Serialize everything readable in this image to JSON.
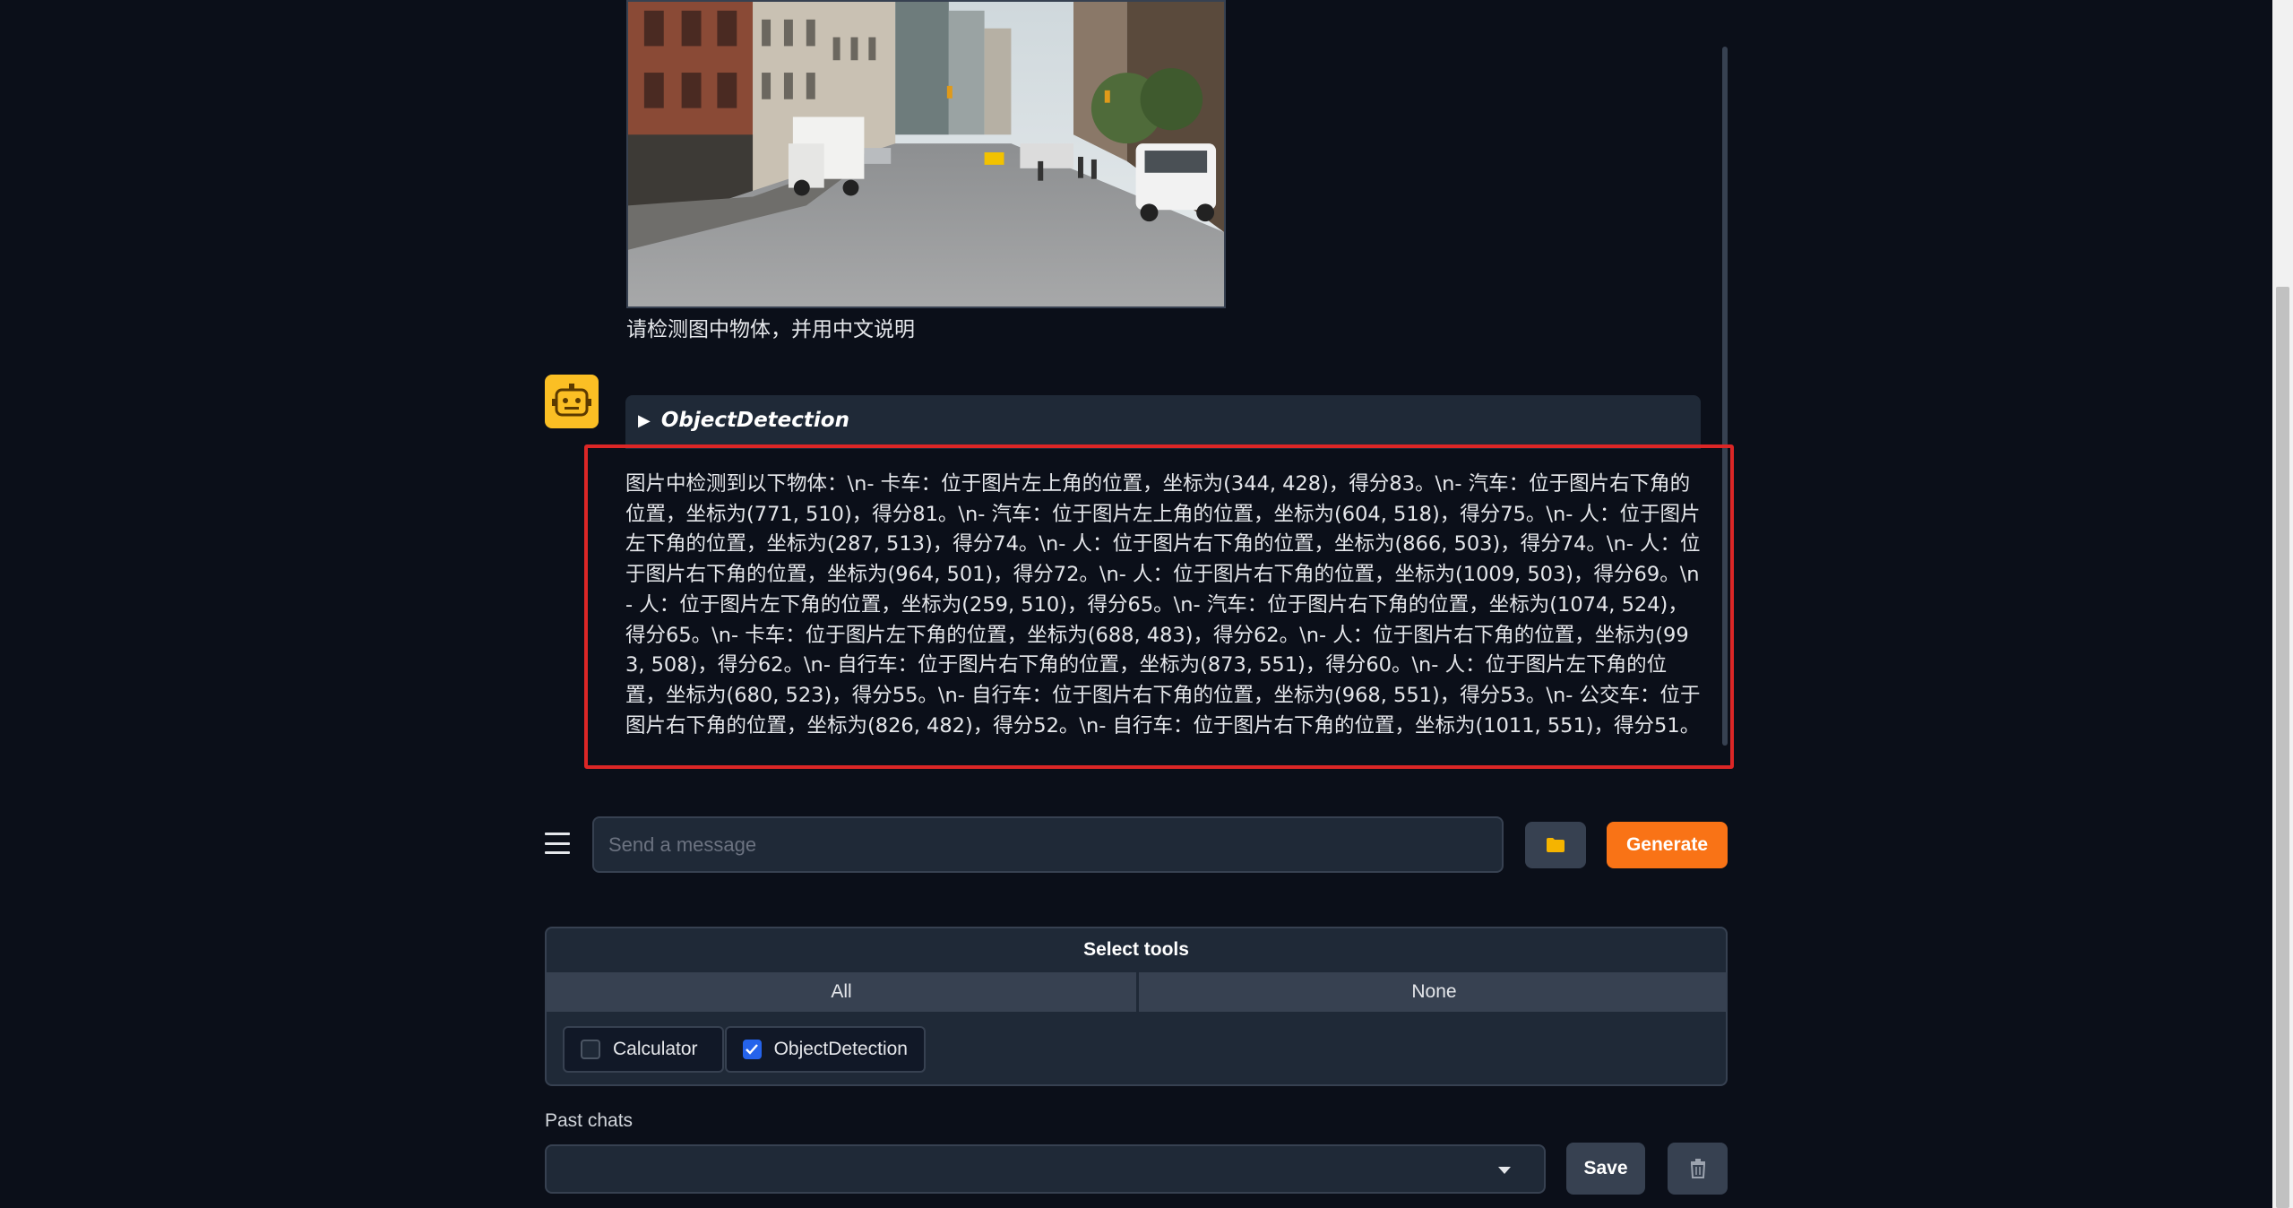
{
  "conversation": {
    "user_message": "请检测图中物体，并用中文说明",
    "tool_used": "ObjectDetection",
    "assistant_answer": "图片中检测到以下物体：\\n- 卡车：位于图片左上角的位置，坐标为(344, 428)，得分83。\\n- 汽车：位于图片右下角的位置，坐标为(771, 510)，得分81。\\n- 汽车：位于图片左上角的位置，坐标为(604, 518)，得分75。\\n- 人：位于图片左下角的位置，坐标为(287, 513)，得分74。\\n- 人：位于图片右下角的位置，坐标为(866, 503)，得分74。\\n- 人：位于图片右下角的位置，坐标为(964, 501)，得分72。\\n- 人：位于图片右下角的位置，坐标为(1009, 503)，得分69。\\n- 人：位于图片左下角的位置，坐标为(259, 510)，得分65。\\n- 汽车：位于图片右下角的位置，坐标为(1074, 524)，得分65。\\n- 卡车：位于图片左下角的位置，坐标为(688, 483)，得分62。\\n- 人：位于图片右下角的位置，坐标为(993, 508)，得分62。\\n- 自行车：位于图片右下角的位置，坐标为(873, 551)，得分60。\\n- 人：位于图片左下角的位置，坐标为(680, 523)，得分55。\\n- 自行车：位于图片右下角的位置，坐标为(968, 551)，得分53。\\n- 公交车：位于图片右下角的位置，坐标为(826, 482)，得分52。\\n- 自行车：位于图片右下角的位置，坐标为(1011, 551)，得分51。"
  },
  "input": {
    "placeholder": "Send a message",
    "generate_label": "Generate",
    "upload_icon": "folder-icon",
    "menu_icon": "menu-icon"
  },
  "select_tools": {
    "title": "Select tools",
    "all_label": "All",
    "none_label": "None",
    "options": [
      {
        "label": "Calculator",
        "checked": false
      },
      {
        "label": "ObjectDetection",
        "checked": true
      }
    ]
  },
  "past_chats": {
    "label": "Past chats",
    "selected": "",
    "save_label": "Save",
    "delete_icon": "trash-icon"
  },
  "colors": {
    "background": "#0b0f19",
    "accent": "#f97316",
    "highlight_border": "#dc2626",
    "avatar": "#fbbf24",
    "checkbox_checked": "#2563eb"
  }
}
